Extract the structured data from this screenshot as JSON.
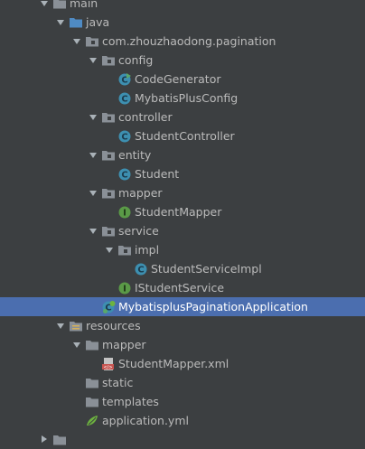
{
  "project_tree": {
    "items": [
      {
        "label": "main",
        "depth": 2,
        "icon": "folder-icon",
        "expanded": true
      },
      {
        "label": "java",
        "depth": 3,
        "icon": "source-folder-icon",
        "expanded": true
      },
      {
        "label": "com.zhouzhaodong.pagination",
        "depth": 4,
        "icon": "package-icon",
        "expanded": true
      },
      {
        "label": "config",
        "depth": 5,
        "icon": "package-icon",
        "expanded": true
      },
      {
        "label": "CodeGenerator",
        "depth": 6,
        "icon": "runnable-class-icon",
        "expanded": null
      },
      {
        "label": "MybatisPlusConfig",
        "depth": 6,
        "icon": "class-icon",
        "expanded": null
      },
      {
        "label": "controller",
        "depth": 5,
        "icon": "package-icon",
        "expanded": true
      },
      {
        "label": "StudentController",
        "depth": 6,
        "icon": "class-icon",
        "expanded": null
      },
      {
        "label": "entity",
        "depth": 5,
        "icon": "package-icon",
        "expanded": true
      },
      {
        "label": "Student",
        "depth": 6,
        "icon": "class-icon",
        "expanded": null
      },
      {
        "label": "mapper",
        "depth": 5,
        "icon": "package-icon",
        "expanded": true
      },
      {
        "label": "StudentMapper",
        "depth": 6,
        "icon": "interface-icon",
        "expanded": null
      },
      {
        "label": "service",
        "depth": 5,
        "icon": "package-icon",
        "expanded": true
      },
      {
        "label": "impl",
        "depth": 6,
        "icon": "package-icon",
        "expanded": true
      },
      {
        "label": "StudentServiceImpl",
        "depth": 7,
        "icon": "class-icon",
        "expanded": null
      },
      {
        "label": "IStudentService",
        "depth": 6,
        "icon": "interface-icon",
        "expanded": null
      },
      {
        "label": "MybatisplusPaginationApplication",
        "depth": 5,
        "icon": "spring-boot-class-icon",
        "expanded": null,
        "selected": true
      },
      {
        "label": "resources",
        "depth": 3,
        "icon": "resources-folder-icon",
        "expanded": true
      },
      {
        "label": "mapper",
        "depth": 4,
        "icon": "folder-icon",
        "expanded": true
      },
      {
        "label": "StudentMapper.xml",
        "depth": 5,
        "icon": "xml-file-icon",
        "expanded": null
      },
      {
        "label": "static",
        "depth": 4,
        "icon": "folder-icon",
        "expanded": null
      },
      {
        "label": "templates",
        "depth": 4,
        "icon": "folder-icon",
        "expanded": null
      },
      {
        "label": "application.yml",
        "depth": 4,
        "icon": "yml-file-icon",
        "expanded": null
      },
      {
        "label": "",
        "depth": 2,
        "icon": "folder-icon",
        "expanded": false
      }
    ]
  },
  "colors": {
    "background": "#3c3f41",
    "selection": "#4b6eaf",
    "text": "#bbbbbb",
    "class_icon": "#3d8fb0",
    "interface_icon": "#5a9a47",
    "folder": "#8a9097",
    "source_folder": "#4f8bc4"
  }
}
